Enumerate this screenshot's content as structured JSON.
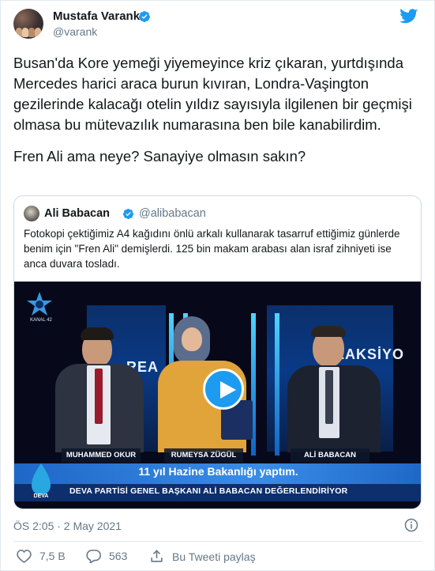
{
  "tweet": {
    "author": {
      "name": "Mustafa Varank",
      "handle": "@varank",
      "verified": true
    },
    "text_paragraphs": [
      "Busan'da Kore yemeği yiyemeyince kriz çıkaran, yurtdışında Mercedes harici araca burun kıvıran, Londra-Vaşington gezilerinde kalacağı otelin yıldız sayısıyla ilgilenen bir geçmişi olmasa bu mütevazılık numarasına ben bile kanabilirdim.",
      "Fren Ali ama neye? Sanayiye olmasın sakın?"
    ],
    "timestamp": "ÖS 2:05 · 2 May 2021",
    "actions": {
      "likes": "7,5 B",
      "replies": "563",
      "share_label": "Bu Tweeti paylaş"
    }
  },
  "quoted_tweet": {
    "author": {
      "name": "Ali Babacan",
      "handle": "@alibabacan",
      "verified": true
    },
    "text": "Fotokopi çektiğimiz A4 kağıdını önlü arkalı kullanarak tasarruf ettiğimiz günlerde benim için \"Fren Ali\" demişlerdi. 125 bin makam arabası alan israf zihniyeti ise anca duvara tosladı.",
    "video": {
      "channel_logo_text": "KANAL 42",
      "backdrop_left": "REA",
      "backdrop_right": "REAKSİYO",
      "nameplates": [
        "MUHAMMED OKUR",
        "RUMEYSA ZÜGÜL",
        "ALİ BABACAN"
      ],
      "headline": "11 yıl Hazine Bakanlığı yaptım.",
      "subline": "DEVA PARTİSİ GENEL BAŞKANI ALİ BABACAN DEĞERLENDİRİYOR",
      "party_logo_text": "DEVA"
    }
  },
  "colors": {
    "twitter_blue": "#1d9bf0",
    "secondary_text": "#657786",
    "border": "#cfd9de"
  },
  "icons": [
    "verified-badge-icon",
    "twitter-bird-icon",
    "play-icon",
    "info-icon",
    "heart-icon",
    "reply-icon",
    "share-icon"
  ]
}
